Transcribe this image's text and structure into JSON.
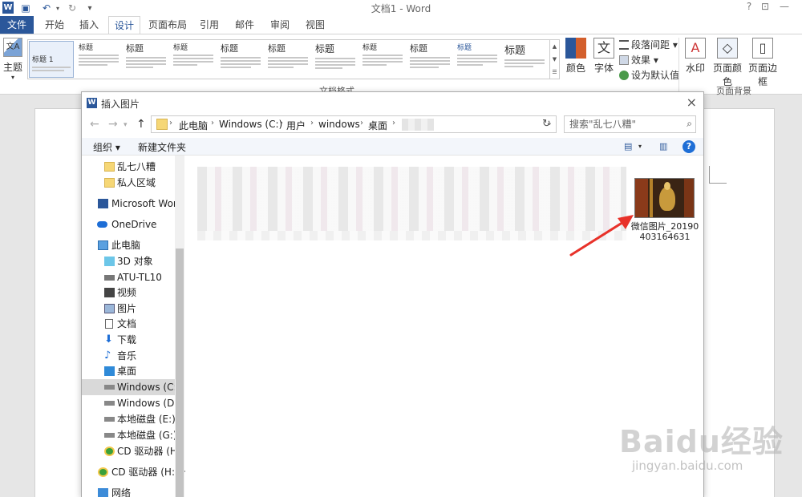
{
  "app": {
    "window_title": "文档1 - Word",
    "quick_access": [
      "save-icon",
      "undo-icon",
      "redo-icon",
      "customize-icon"
    ],
    "window_controls": [
      "?",
      "restore-icon",
      "minimize-icon"
    ]
  },
  "ribbon_tabs": [
    {
      "label": "文件"
    },
    {
      "label": "开始"
    },
    {
      "label": "插入"
    },
    {
      "label": "设计"
    },
    {
      "label": "页面布局"
    },
    {
      "label": "引用"
    },
    {
      "label": "邮件"
    },
    {
      "label": "审阅"
    },
    {
      "label": "视图"
    }
  ],
  "ribbon": {
    "theme_label": "主题",
    "theme_icon_text": "文A",
    "style_gallery": [
      {
        "title": "标题 1"
      },
      {
        "title": "标题"
      },
      {
        "title": "标题"
      },
      {
        "title": "标题"
      },
      {
        "title": "标题"
      },
      {
        "title": "标题"
      },
      {
        "title": "标题"
      },
      {
        "title": "标题"
      },
      {
        "title": "标题"
      },
      {
        "title": "标题"
      },
      {
        "title": "标题"
      }
    ],
    "document_format_label": "文档格式",
    "colors_label": "颜色",
    "fonts_label": "字体",
    "fonts_icon_text": "文",
    "paragraph_spacing_label": "段落间距",
    "effects_label": "效果",
    "set_default_label": "设为默认值",
    "watermark_label": "水印",
    "page_color_label": "页面颜色",
    "page_borders_label": "页面边框",
    "page_background_label": "页面背景"
  },
  "dialog": {
    "title": "插入图片",
    "breadcrumbs": [
      "此电脑",
      "Windows (C:)",
      "用户",
      "windows",
      "桌面"
    ],
    "search_placeholder": "搜索\"乱七八糟\"",
    "organize_label": "组织 ▾",
    "new_folder_label": "新建文件夹",
    "sidebar": [
      {
        "label": "乱七八糟",
        "icon": "folder-icon"
      },
      {
        "label": "私人区域",
        "icon": "folder-icon"
      },
      {
        "label": "Microsoft Word",
        "icon": "word-icon"
      },
      {
        "label": "OneDrive",
        "icon": "onedrive-icon"
      },
      {
        "label": "此电脑",
        "icon": "computer-icon"
      },
      {
        "label": "3D 对象",
        "icon": "3d-objects-icon"
      },
      {
        "label": "ATU-TL10",
        "icon": "device-icon"
      },
      {
        "label": "视频",
        "icon": "video-icon"
      },
      {
        "label": "图片",
        "icon": "pictures-icon"
      },
      {
        "label": "文档",
        "icon": "documents-icon"
      },
      {
        "label": "下载",
        "icon": "download-icon"
      },
      {
        "label": "音乐",
        "icon": "music-icon"
      },
      {
        "label": "桌面",
        "icon": "desktop-icon"
      },
      {
        "label": "Windows (C:)",
        "icon": "drive-icon",
        "selected": true
      },
      {
        "label": "Windows (D:)",
        "icon": "drive-icon"
      },
      {
        "label": "本地磁盘 (E:)",
        "icon": "drive-icon"
      },
      {
        "label": "本地磁盘 (G:)",
        "icon": "drive-icon"
      },
      {
        "label": "CD 驱动器 (H:)",
        "icon": "cd-drive-icon"
      },
      {
        "label": "CD 驱动器 (H:) H",
        "icon": "cd-drive-icon"
      },
      {
        "label": "网络",
        "icon": "network-icon"
      }
    ],
    "file": {
      "name": "微信图片_20190403164631"
    }
  },
  "watermark": {
    "main": "Baidu经验",
    "sub": "jingyan.baidu.com"
  },
  "colors": {
    "accent": "#2b579a",
    "arrow": "#e8322a",
    "selection": "#d9d9d9"
  }
}
